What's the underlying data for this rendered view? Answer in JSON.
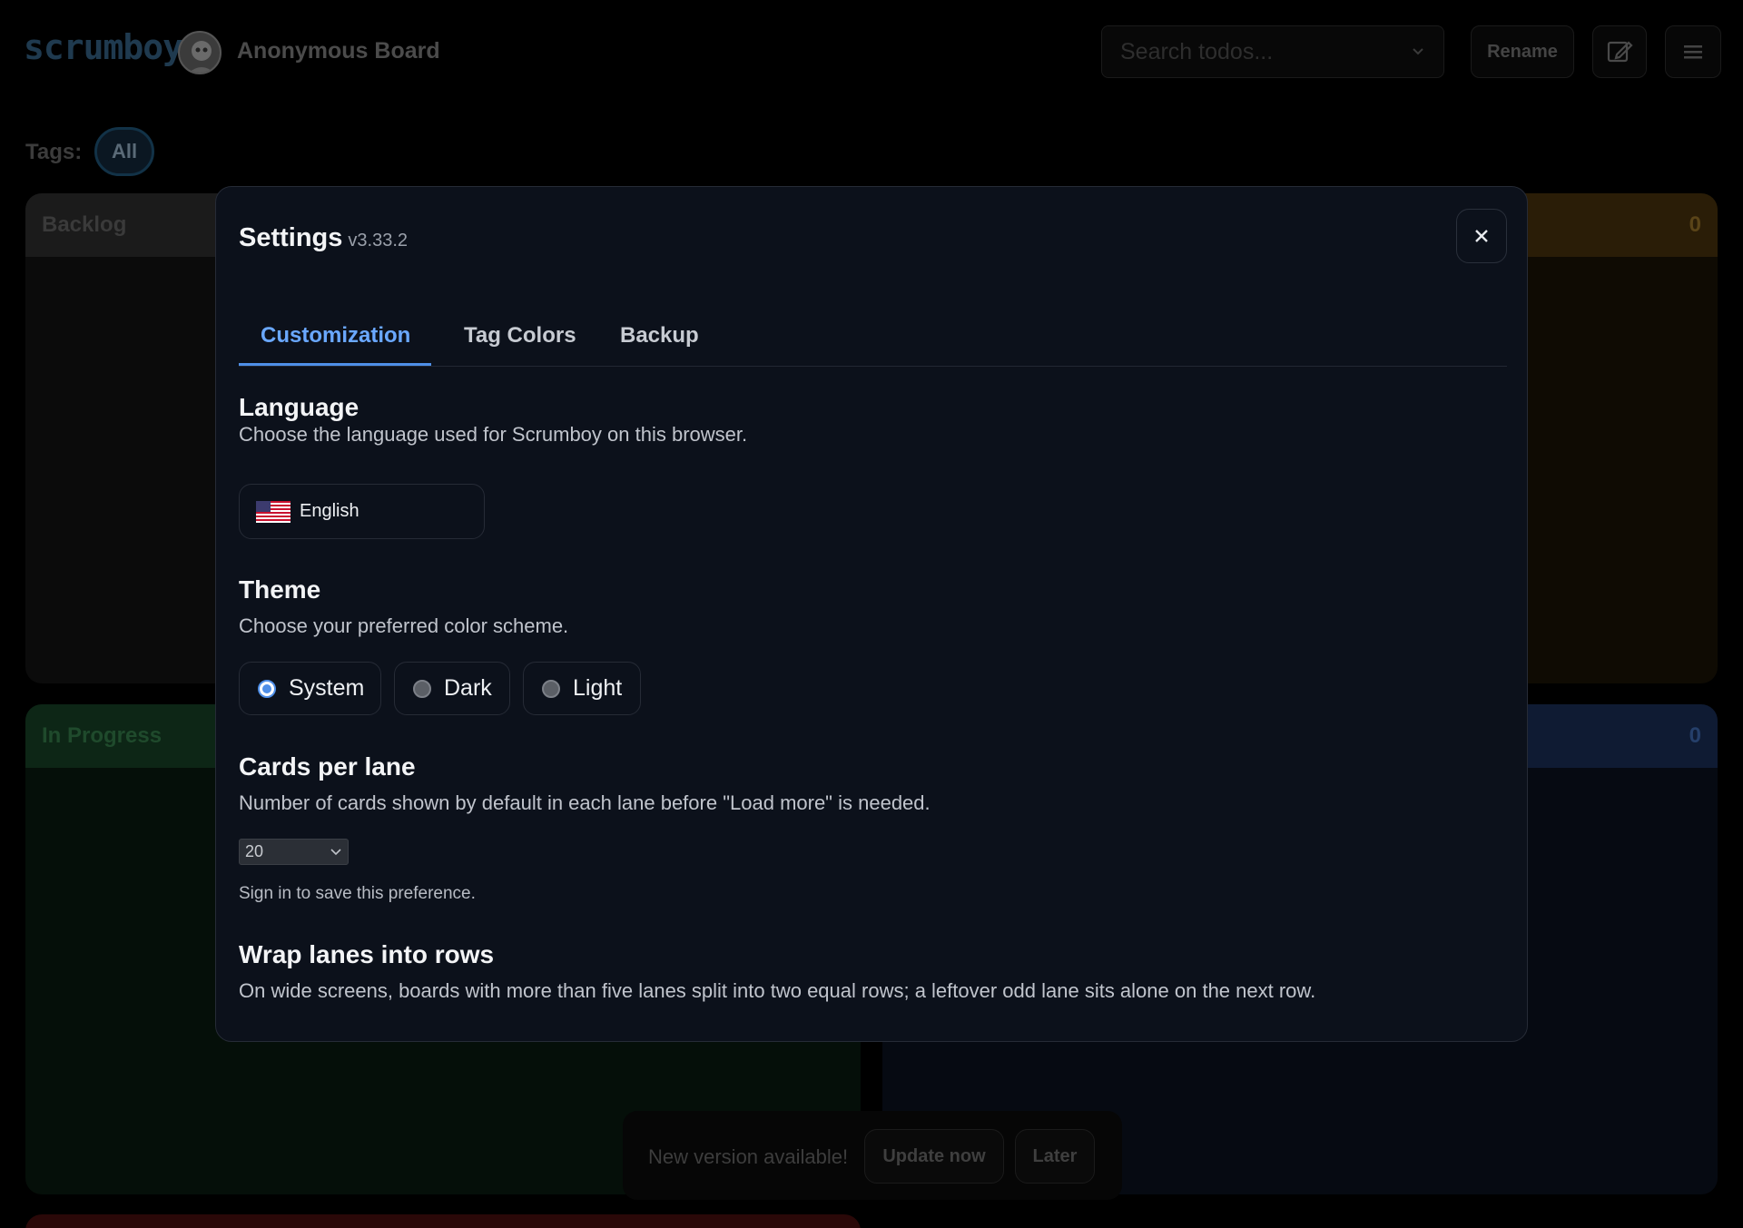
{
  "header": {
    "logo_text": "scrumboy",
    "board_title": "Anonymous Board",
    "search_placeholder": "Search todos...",
    "rename_label": "Rename",
    "edit_icon": "edit-icon",
    "menu_icon": "hamburger-menu-icon"
  },
  "tags": {
    "label": "Tags:",
    "items": [
      "All"
    ]
  },
  "lanes": [
    {
      "name": "Backlog",
      "count": "",
      "color": "#1b1b1b"
    },
    {
      "name": "",
      "count": "0",
      "color": "#1f1505"
    },
    {
      "name": "In Progress",
      "count": "",
      "color": "#0a1f13"
    },
    {
      "name": "",
      "count": "0",
      "color": "#0d1626"
    }
  ],
  "modal": {
    "title": "Settings",
    "version": "v3.33.2",
    "close_icon": "close-icon",
    "tabs": [
      {
        "label": "Customization",
        "active": true
      },
      {
        "label": "Tag Colors",
        "active": false
      },
      {
        "label": "Backup",
        "active": false
      }
    ],
    "language": {
      "title": "Language",
      "description": "Choose the language used for Scrumboy on this browser.",
      "selected": "English",
      "flag_icon": "us-flag-icon"
    },
    "theme": {
      "title": "Theme",
      "description": "Choose your preferred color scheme.",
      "options": [
        {
          "label": "System",
          "selected": true
        },
        {
          "label": "Dark",
          "selected": false
        },
        {
          "label": "Light",
          "selected": false
        }
      ]
    },
    "cards_per_lane": {
      "title": "Cards per lane",
      "description": "Number of cards shown by default in each lane before \"Load more\" is needed.",
      "value": "20",
      "hint": "Sign in to save this preference."
    },
    "wrap_lanes": {
      "title": "Wrap lanes into rows",
      "description": "On wide screens, boards with more than five lanes split into two equal rows; a leftover odd lane sits alone on the next row."
    }
  },
  "toast": {
    "message": "New version available!",
    "update_label": "Update now",
    "later_label": "Later"
  },
  "colors": {
    "accent": "#6aa8ff",
    "modal_bg": "#0c111b"
  }
}
